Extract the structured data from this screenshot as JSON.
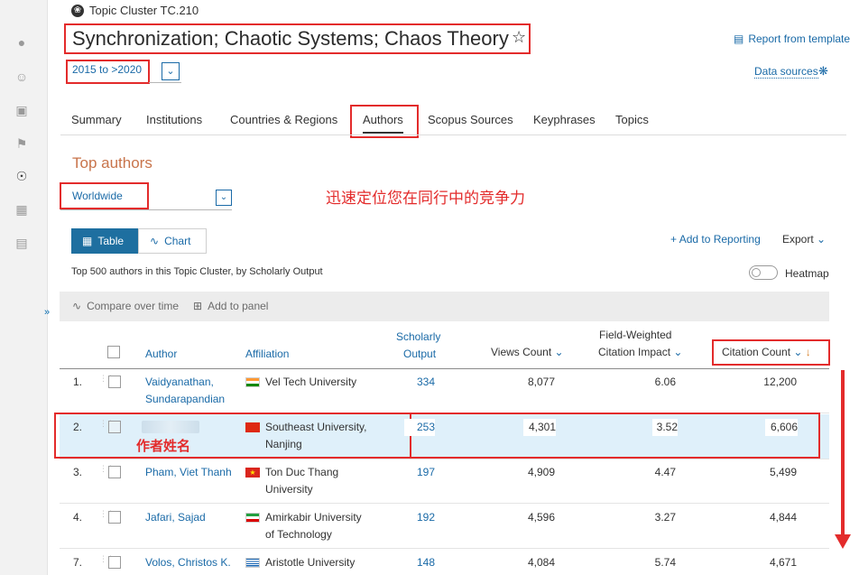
{
  "breadcrumb": {
    "label": "Topic Cluster TC.210"
  },
  "page": {
    "title": "Synchronization; Chaotic Systems; Chaos Theory",
    "year_range": "2015 to >2020",
    "report_from_template": "Report from template",
    "data_sources": "Data sources"
  },
  "tabs": [
    "Summary",
    "Institutions",
    "Countries & Regions",
    "Authors",
    "Scopus Sources",
    "Keyphrases",
    "Topics"
  ],
  "section": {
    "title": "Top authors",
    "scope": "Worldwide",
    "annotation": "迅速定位您在同行中的竞争力"
  },
  "view_toggle": {
    "table": "Table",
    "chart": "Chart"
  },
  "actions": {
    "add_to_reporting": "Add to Reporting",
    "export": "Export"
  },
  "description": "Top 500 authors in this Topic Cluster, by Scholarly Output",
  "heatmap": {
    "label": "Heatmap",
    "enabled": false
  },
  "toolbar": {
    "compare": "Compare over time",
    "add_panel": "Add to panel"
  },
  "columns": {
    "author": "Author",
    "affiliation": "Affiliation",
    "scholarly_output_1": "Scholarly",
    "scholarly_output_2": "Output",
    "views": "Views Count",
    "fwci_1": "Field-Weighted",
    "fwci_2": "Citation Impact",
    "citations": "Citation Count"
  },
  "rows": [
    {
      "rank": "1.",
      "author_1": "Vaidyanathan,",
      "author_2": "Sundarapandian",
      "affil_1": "Vel Tech University",
      "affil_2": "",
      "flag": "india",
      "output": "334",
      "views": "8,077",
      "fwci": "6.06",
      "citations": "12,200"
    },
    {
      "rank": "2.",
      "author_1": "",
      "author_2": "",
      "affil_1": "Southeast University,",
      "affil_2": "Nanjing",
      "flag": "china",
      "output": "253",
      "views": "4,301",
      "fwci": "3.52",
      "citations": "6,606"
    },
    {
      "rank": "3.",
      "author_1": "Pham, Viet Thanh",
      "author_2": "",
      "affil_1": "Ton Duc Thang",
      "affil_2": "University",
      "flag": "vietnam",
      "output": "197",
      "views": "4,909",
      "fwci": "4.47",
      "citations": "5,499"
    },
    {
      "rank": "4.",
      "author_1": "Jafari, Sajad",
      "author_2": "",
      "affil_1": "Amirkabir University",
      "affil_2": "of Technology",
      "flag": "iran",
      "output": "192",
      "views": "4,596",
      "fwci": "3.27",
      "citations": "4,844"
    },
    {
      "rank": "7.",
      "author_1": "Volos, Christos K.",
      "author_2": "",
      "affil_1": "Aristotle University",
      "affil_2": "",
      "flag": "greece",
      "output": "148",
      "views": "4,084",
      "fwci": "5.74",
      "citations": "4,671"
    }
  ],
  "author_annotation": "作者姓名",
  "colors": {
    "accent": "#1a6aa7",
    "annotation": "#e32b2b",
    "section_title": "#c8744b",
    "highlight": "#dff0fa"
  }
}
